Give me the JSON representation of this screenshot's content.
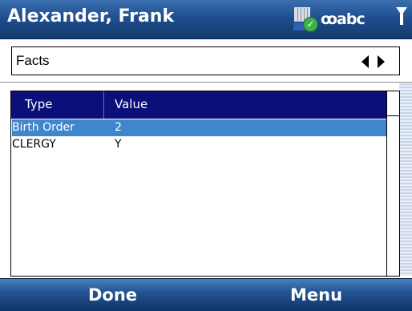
{
  "header": {
    "title": "Alexander, Frank",
    "input_mode": "abc",
    "icons": [
      "device-sync-icon",
      "voicemail-icon",
      "signal-icon"
    ]
  },
  "selector": {
    "label": "Facts",
    "icons": [
      "arrow-left-icon",
      "arrow-right-icon"
    ]
  },
  "table": {
    "columns": [
      "Type",
      "Value"
    ],
    "rows": [
      {
        "type": "Birth Order",
        "value": "2",
        "selected": true
      },
      {
        "type": "CLERGY",
        "value": "Y",
        "selected": false
      }
    ]
  },
  "softkeys": {
    "left": "Done",
    "right": "Menu"
  },
  "colors": {
    "header_bar": "#1f4f8e",
    "list_header": "#0a0f7a",
    "selection": "#3f86cd"
  }
}
